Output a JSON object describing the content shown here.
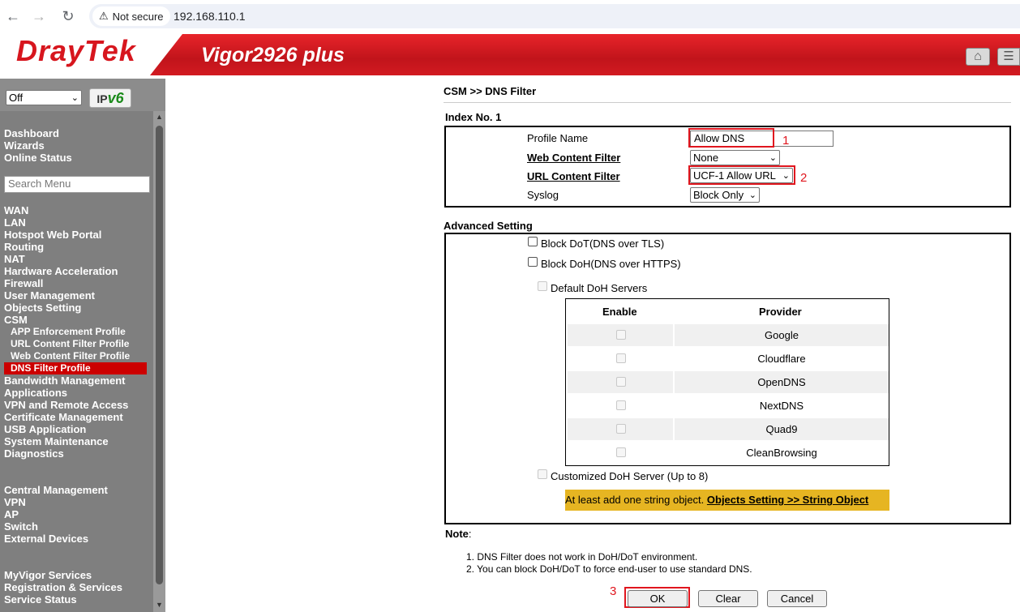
{
  "browser": {
    "security_label": "Not secure",
    "url": "192.168.110.1"
  },
  "banner": {
    "logo": "DrayTek",
    "model": "Vigor2926 plus"
  },
  "sidebar": {
    "language_value": "Off",
    "ipv6_label": "IPv6",
    "search_placeholder": "Search Menu",
    "top_items": [
      "Dashboard",
      "Wizards",
      "Online Status"
    ],
    "main_items": [
      "WAN",
      "LAN",
      "Hotspot Web Portal",
      "Routing",
      "NAT",
      "Hardware Acceleration",
      "Firewall",
      "User Management",
      "Objects Setting",
      "CSM"
    ],
    "csm_sub": [
      "APP Enforcement Profile",
      "URL Content Filter Profile",
      "Web Content Filter Profile"
    ],
    "active_item": "DNS Filter Profile",
    "after_items": [
      "Bandwidth Management",
      "Applications",
      "VPN and Remote Access",
      "Certificate Management",
      "USB Application",
      "System Maintenance",
      "Diagnostics"
    ],
    "central_items": [
      "Central Management",
      "VPN",
      "AP",
      "Switch",
      "External Devices"
    ],
    "myvigor_items": [
      "MyVigor Services",
      "Registration & Services",
      "Service Status"
    ]
  },
  "page": {
    "breadcrumb": "CSM >> DNS Filter",
    "index_title": "Index No. 1",
    "profile_name_label": "Profile Name",
    "profile_name_value": "Allow DNS",
    "web_filter_label": "Web Content Filter",
    "web_filter_value": "None",
    "url_filter_label": "URL Content Filter",
    "url_filter_value": "UCF-1 Allow URL",
    "syslog_label": "Syslog",
    "syslog_value": "Block Only",
    "advanced_title": "Advanced Setting",
    "block_dot": "Block DoT(DNS over TLS)",
    "block_doh": "Block DoH(DNS over HTTPS)",
    "default_doh": "Default DoH Servers",
    "col_enable": "Enable",
    "col_provider": "Provider",
    "providers": [
      "Google",
      "Cloudflare",
      "OpenDNS",
      "NextDNS",
      "Quad9",
      "CleanBrowsing"
    ],
    "custom_doh": "Customized DoH Server (Up to 8)",
    "notice_text": "At least add one string object. ",
    "notice_link": "Objects Setting >> String Object",
    "note_title": "Note",
    "note_colon": ":",
    "notes": [
      "1. DNS Filter does not work in DoH/DoT environment.",
      "2. You can block DoH/DoT to force end-user to use standard DNS."
    ],
    "ok": "OK",
    "clear": "Clear",
    "cancel": "Cancel"
  },
  "annotations": {
    "n1": "1",
    "n2": "2",
    "n3": "3",
    "color": "#e0161e"
  }
}
